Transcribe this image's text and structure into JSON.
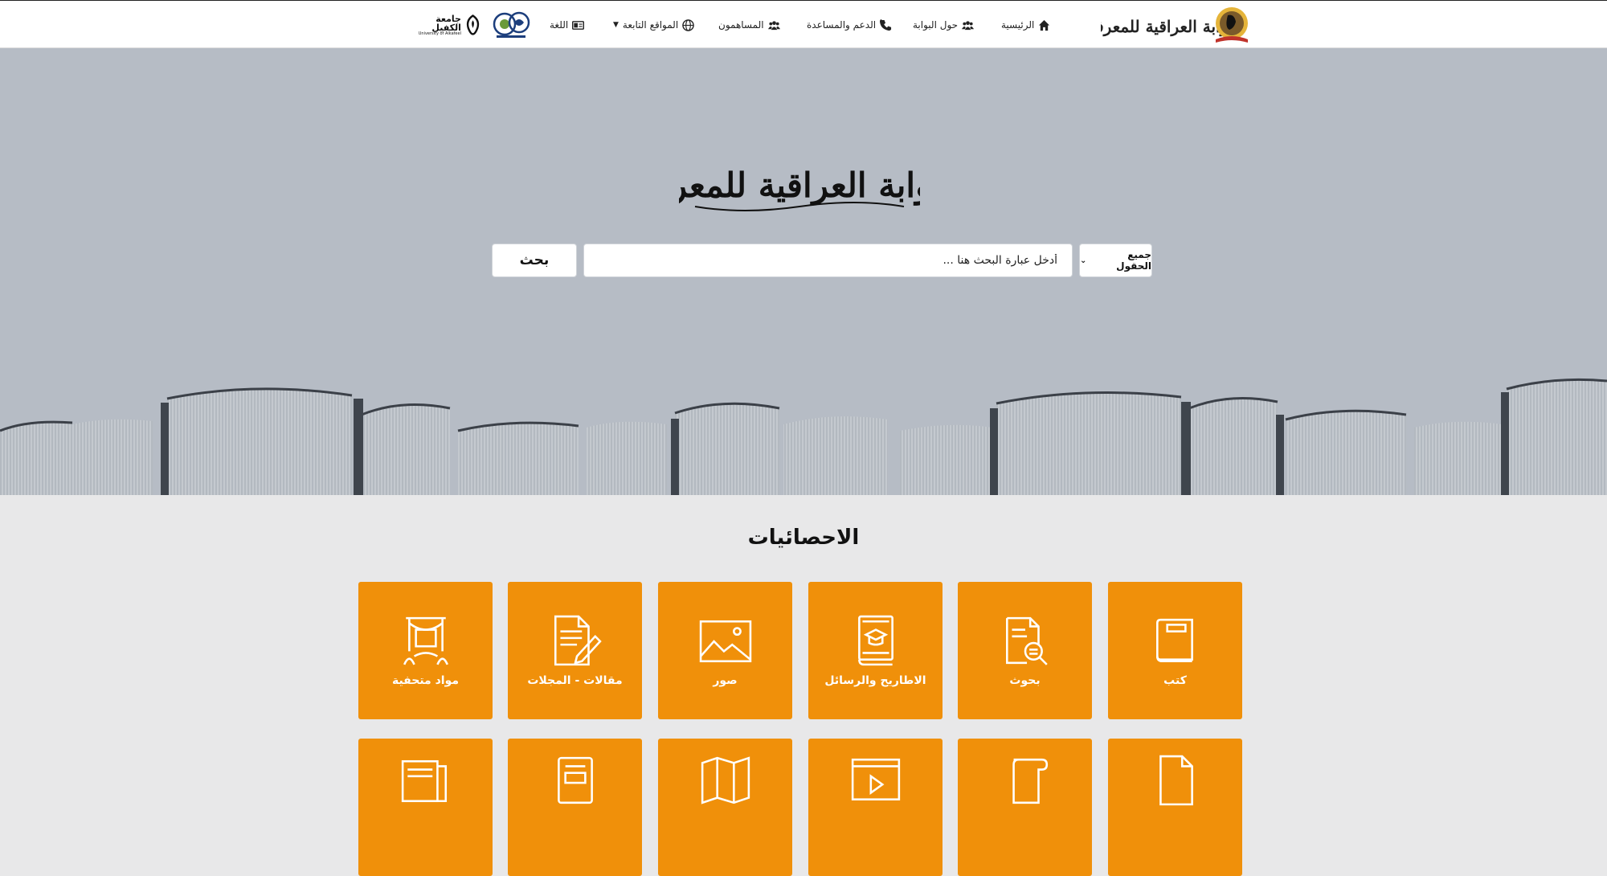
{
  "nav": {
    "items": [
      {
        "label": "الرئيسية",
        "icon": "home-icon"
      },
      {
        "label": "حول البوابة",
        "icon": "users-icon"
      },
      {
        "label": "الدعم والمساعدة",
        "icon": "phone-icon"
      },
      {
        "label": "المساهمون",
        "icon": "users-icon"
      },
      {
        "label": "المواقع التابعة",
        "icon": "globe-icon"
      },
      {
        "label": "اللغة",
        "icon": "language-icon"
      }
    ],
    "partner_logo_text": "جامعة الكفيل",
    "partner_logo_subtext": "University of Alkafeel"
  },
  "hero": {
    "title_logo_text": "البوابة العراقية للمعرفة",
    "search_scope": "جميع الحقول",
    "search_placeholder": "أدخل عبارة البحث هنا ...",
    "search_button": "بحث"
  },
  "stats": {
    "title": "الاحصائيات",
    "row1": [
      {
        "label": "كتب",
        "icon": "book-icon"
      },
      {
        "label": "بحوث",
        "icon": "research-icon"
      },
      {
        "label": "الاطاريح والرسائل",
        "icon": "thesis-icon"
      },
      {
        "label": "صور",
        "icon": "image-icon"
      },
      {
        "label": "مقالات - المجلات",
        "icon": "article-icon"
      },
      {
        "label": "مواد متحفية",
        "icon": "museum-icon"
      }
    ],
    "row2_icons": [
      "document-icon",
      "scroll-icon",
      "video-icon",
      "map-icon",
      "newspaper-icon",
      "magazine-icon"
    ]
  },
  "colors": {
    "accent": "#f0900a",
    "hero_bg": "#b6bcc5",
    "page_bg": "#e8e8e9"
  }
}
